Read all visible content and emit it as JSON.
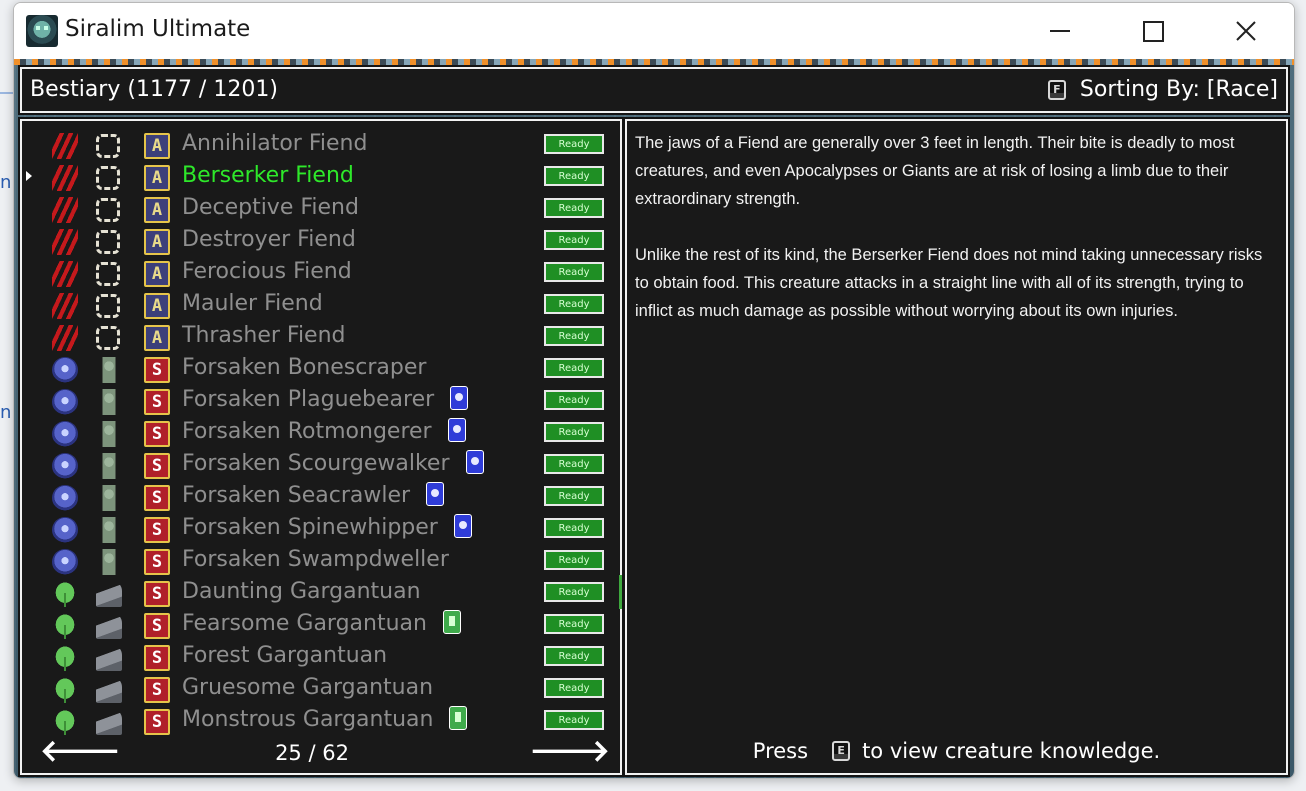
{
  "window": {
    "title": "Siralim Ultimate",
    "controls": {
      "minimize_icon": "minimize-icon",
      "maximize_icon": "maximize-icon",
      "close_icon": "close-icon"
    }
  },
  "header": {
    "title": "Bestiary (1177 / 1201)",
    "sort_key": "F",
    "sort_label": "Sorting By: [Race]"
  },
  "creatures": [
    {
      "name": "Annihilator Fiend",
      "race_icon": "claw-icon",
      "class_icon": "ring-icon",
      "badge": "A",
      "trait": "",
      "status": "Ready",
      "selected": false
    },
    {
      "name": "Berserker Fiend",
      "race_icon": "claw-icon",
      "class_icon": "ring-icon",
      "badge": "A",
      "trait": "",
      "status": "Ready",
      "selected": true
    },
    {
      "name": "Deceptive Fiend",
      "race_icon": "claw-icon",
      "class_icon": "ring-icon",
      "badge": "A",
      "trait": "",
      "status": "Ready",
      "selected": false
    },
    {
      "name": "Destroyer Fiend",
      "race_icon": "claw-icon",
      "class_icon": "ring-icon",
      "badge": "A",
      "trait": "",
      "status": "Ready",
      "selected": false
    },
    {
      "name": "Ferocious Fiend",
      "race_icon": "claw-icon",
      "class_icon": "ring-icon",
      "badge": "A",
      "trait": "",
      "status": "Ready",
      "selected": false
    },
    {
      "name": "Mauler Fiend",
      "race_icon": "claw-icon",
      "class_icon": "ring-icon",
      "badge": "A",
      "trait": "",
      "status": "Ready",
      "selected": false
    },
    {
      "name": "Thrasher Fiend",
      "race_icon": "claw-icon",
      "class_icon": "ring-icon",
      "badge": "A",
      "trait": "",
      "status": "Ready",
      "selected": false
    },
    {
      "name": "Forsaken Bonescraper",
      "race_icon": "skull-icon",
      "class_icon": "zombie-icon",
      "badge": "S",
      "trait": "",
      "status": "Ready",
      "selected": false
    },
    {
      "name": "Forsaken Plaguebearer",
      "race_icon": "skull-icon",
      "class_icon": "zombie-icon",
      "badge": "S",
      "trait": "blue",
      "status": "Ready",
      "selected": false
    },
    {
      "name": "Forsaken Rotmongerer",
      "race_icon": "skull-icon",
      "class_icon": "zombie-icon",
      "badge": "S",
      "trait": "blue",
      "status": "Ready",
      "selected": false
    },
    {
      "name": "Forsaken Scourgewalker",
      "race_icon": "skull-icon",
      "class_icon": "zombie-icon",
      "badge": "S",
      "trait": "blue",
      "status": "Ready",
      "selected": false
    },
    {
      "name": "Forsaken Seacrawler",
      "race_icon": "skull-icon",
      "class_icon": "zombie-icon",
      "badge": "S",
      "trait": "blue",
      "status": "Ready",
      "selected": false
    },
    {
      "name": "Forsaken Spinewhipper",
      "race_icon": "skull-icon",
      "class_icon": "zombie-icon",
      "badge": "S",
      "trait": "blue",
      "status": "Ready",
      "selected": false
    },
    {
      "name": "Forsaken Swampdweller",
      "race_icon": "skull-icon",
      "class_icon": "zombie-icon",
      "badge": "S",
      "trait": "",
      "status": "Ready",
      "selected": false
    },
    {
      "name": "Daunting Gargantuan",
      "race_icon": "leaf-icon",
      "class_icon": "rock-icon",
      "badge": "S",
      "trait": "",
      "status": "Ready",
      "selected": false
    },
    {
      "name": "Fearsome Gargantuan",
      "race_icon": "leaf-icon",
      "class_icon": "rock-icon",
      "badge": "S",
      "trait": "green",
      "status": "Ready",
      "selected": false
    },
    {
      "name": "Forest Gargantuan",
      "race_icon": "leaf-icon",
      "class_icon": "rock-icon",
      "badge": "S",
      "trait": "",
      "status": "Ready",
      "selected": false
    },
    {
      "name": "Gruesome Gargantuan",
      "race_icon": "leaf-icon",
      "class_icon": "rock-icon",
      "badge": "S",
      "trait": "",
      "status": "Ready",
      "selected": false
    },
    {
      "name": "Monstrous Gargantuan",
      "race_icon": "leaf-icon",
      "class_icon": "rock-icon",
      "badge": "S",
      "trait": "green",
      "status": "Ready",
      "selected": false
    }
  ],
  "pager": {
    "page": "25 / 62",
    "prev_icon": "arrow-left-icon",
    "next_icon": "arrow-right-icon",
    "prev": "🡐",
    "next": "🡒"
  },
  "description": {
    "paragraph1": "The jaws of a Fiend are generally over 3 feet in length. Their bite is deadly to most creatures, and even Apocalypses or Giants are at risk of losing a limb due to their extraordinary strength.",
    "paragraph2": "Unlike the rest of its kind, the Berserker Fiend does not mind taking unnecessary risks to obtain food. This creature attacks in a straight line with all of its strength, trying to inflict as much damage as possible without worrying about its own injuries."
  },
  "footer": {
    "press": "Press",
    "key": "E",
    "rest": "to view creature knowledge."
  },
  "colors": {
    "selected": "#2ee82a",
    "unselected": "#8f8f8f",
    "ready": "#1f8f24",
    "panel": "#191919"
  }
}
